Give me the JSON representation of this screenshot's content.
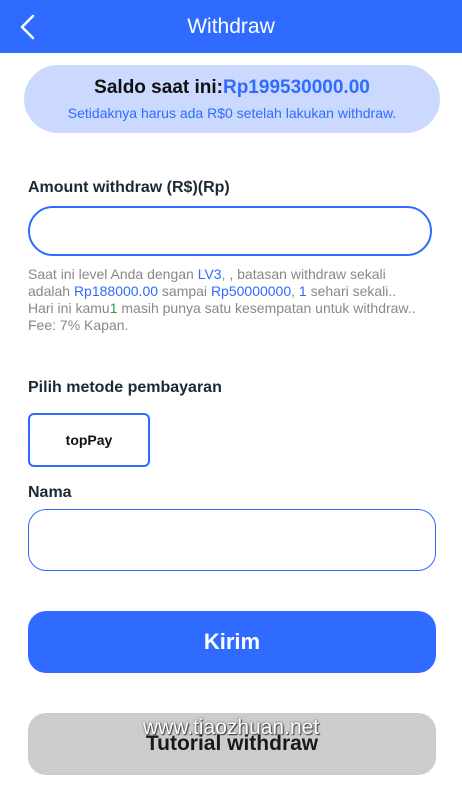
{
  "header": {
    "title": "Withdraw",
    "back_icon": "chevron-left-icon"
  },
  "balance": {
    "label": "Saldo saat ini:",
    "value": "Rp199530000.00",
    "note": "Setidaknya harus ada R$0 setelah lakukan withdraw."
  },
  "amount": {
    "label": "Amount withdraw (R$)(Rp)",
    "value": "",
    "placeholder": ""
  },
  "info": {
    "p1": "Saat ini level Anda dengan ",
    "level": "LV3",
    "p2": ", , batasan withdraw sekali adalah ",
    "min": "Rp188000.00",
    "p3": " sampai ",
    "max": "Rp50000000",
    "p4": ", ",
    "daily": "1",
    "p5": " sehari sekali..",
    "p6": "Hari ini kamu",
    "remaining": "1",
    "p7": " masih punya satu kesempatan untuk withdraw..",
    "fee": "Fee: 7% Kapan."
  },
  "payment": {
    "label": "Pilih metode pembayaran",
    "method": "topPay"
  },
  "nama": {
    "label": "Nama",
    "value": "",
    "placeholder": ""
  },
  "buttons": {
    "submit": "Kirim",
    "tutorial": "Tutorial withdraw"
  },
  "watermark": "www.tiaozhuan.net",
  "colors": {
    "primary": "#2f6bff",
    "card": "#cbd9ff",
    "muted": "#888888",
    "green": "#25a244",
    "gray_button": "#cccccc"
  }
}
